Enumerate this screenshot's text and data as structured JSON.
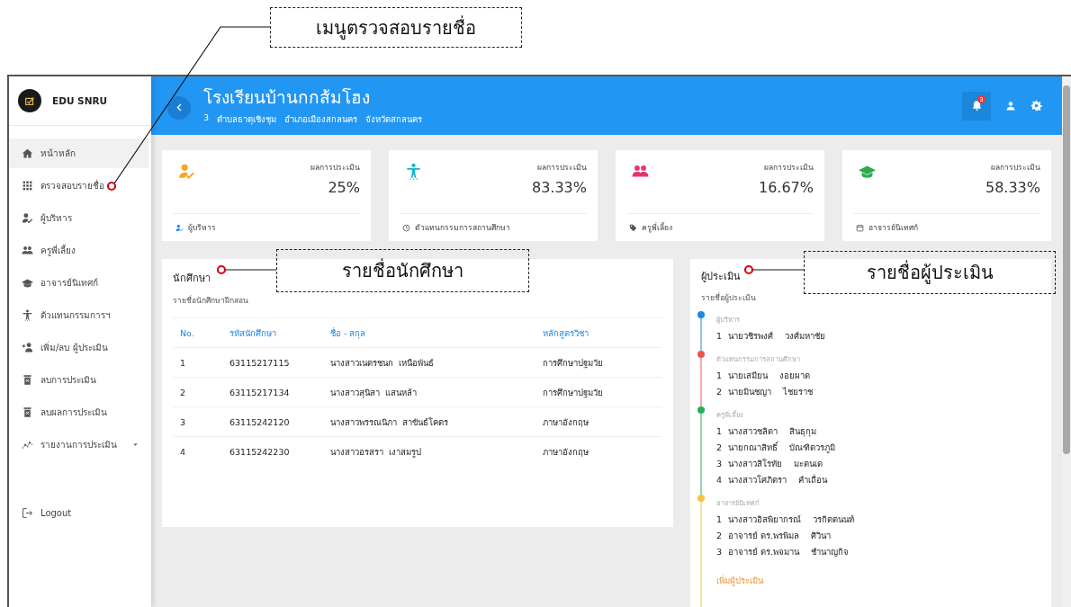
{
  "callouts": [
    {
      "text": "เมนูตรวจสอบรายชื่อ"
    },
    {
      "text": "รายชื่อนักศึกษา"
    },
    {
      "text": "รายชื่อผู้ประเมิน"
    }
  ],
  "sidebar": {
    "brand": "EDU SNRU",
    "items": [
      {
        "label": "หน้าหลัก",
        "kind": "home",
        "selected": true
      },
      {
        "label": "ตรวจสอบรายชื่อ",
        "kind": "grid",
        "selected": false
      },
      {
        "label": "ผู้บริหาร",
        "kind": "user-check",
        "selected": false
      },
      {
        "label": "ครูพี่เลี้ยง",
        "kind": "users",
        "selected": false
      },
      {
        "label": "อาจารย์นิเทศก์",
        "kind": "graduation",
        "selected": false
      },
      {
        "label": "ตัวแทนกรรมการฯ",
        "kind": "accessibility",
        "selected": false
      },
      {
        "label": "เพิ่ม/ลบ ผู้ประเมิน",
        "kind": "user-plus",
        "selected": false
      },
      {
        "label": "ลบการประเมิน",
        "kind": "trash",
        "selected": false
      },
      {
        "label": "ลบผลการประเมิน",
        "kind": "trash",
        "selected": false
      },
      {
        "label": "รายงานการประเมิน",
        "kind": "chart",
        "selected": false,
        "submenu": true
      }
    ],
    "logout": "Logout"
  },
  "header": {
    "title": "โรงเรียนบ้านกกส้มโฮง",
    "address": [
      "3",
      "ตำบลธาตุเชิงชุม",
      "อำเภอเมืองสกลนคร",
      "จังหวัดสกลนคร"
    ],
    "notifications": "3"
  },
  "cards": [
    {
      "kind": "executive",
      "color": "#f5a623",
      "label": "ผลการประเมิน",
      "value": "25%",
      "footer": "ผู้บริหาร"
    },
    {
      "kind": "committee",
      "color": "#17b3c9",
      "label": "ผลการประเมิน",
      "value": "83.33%",
      "footer": "ตัวแทนกรรมการสถานศึกษา"
    },
    {
      "kind": "mentor",
      "color": "#e8336a",
      "label": "ผลการประเมิน",
      "value": "16.67%",
      "footer": "ครูพี่เลี้ยง"
    },
    {
      "kind": "supervisor",
      "color": "#2eaa4f",
      "label": "ผลการประเมิน",
      "value": "58.33%",
      "footer": "อาจารย์นิเทศก์"
    }
  ],
  "students": {
    "title": "นักศึกษา",
    "subtitle": "รายชื่อนักศึกษาฝึกสอน",
    "columns": [
      "No.",
      "รหัสนักศึกษา",
      "ชื่อ - สกุล",
      "หลักสูตรวิชา"
    ],
    "rows": [
      [
        "1",
        "63115217115",
        "นางสาวเนตรชนก  เหนือพันธ์",
        "การศึกษาปฐมวัย"
      ],
      [
        "2",
        "63115217134",
        "นางสาวสุนิสา  แสนหล้า",
        "การศึกษาปฐมวัย"
      ],
      [
        "3",
        "63115242120",
        "นางสาวพรรณนิภา  สาขันธ์โคตร",
        "ภาษาอังกฤษ"
      ],
      [
        "4",
        "63115242230",
        "นางสาวอรสรา  เงาสมรูป",
        "ภาษาอังกฤษ"
      ]
    ]
  },
  "evaluators": {
    "title": "ผู้ประเมิน",
    "subtitle": "รายชื่อผู้ประเมิน",
    "groups": [
      {
        "title": "ผู้บริหาร",
        "color": "#1e88e5",
        "people": [
          {
            "no": "1",
            "name": "นายวชิรพงศ์",
            "surname": "วงศ์มหาชัย"
          }
        ]
      },
      {
        "title": "ตัวแทนกรรมการสถานศึกษา",
        "color": "#ef5350",
        "people": [
          {
            "no": "1",
            "name": "นายเสมียน",
            "surname": "งอยผาด"
          },
          {
            "no": "2",
            "name": "นายมินชญา",
            "surname": "ไชยราช"
          }
        ]
      },
      {
        "title": "ครูพี่เลี้ยง",
        "color": "#21b35b",
        "people": [
          {
            "no": "1",
            "name": "นางสาวชลิดา",
            "surname": "สินธุกุม"
          },
          {
            "no": "2",
            "name": "นายกณาสิทธิ์",
            "surname": "บัณฑิตวรภูมิ"
          },
          {
            "no": "3",
            "name": "นางสาวสิโรทัย",
            "surname": "มะตนเด"
          },
          {
            "no": "4",
            "name": "นางสาวโศภิตรา",
            "surname": "คำเถื่อน"
          }
        ]
      },
      {
        "title": "อาจารย์นิเทศก์",
        "color": "#f7c244",
        "people": [
          {
            "no": "1",
            "name": "นางสาวอิสพิยากรณ์",
            "surname": "วรกิตตนนท์"
          },
          {
            "no": "2",
            "name": "อาจารย์ ดร.พรพิมล",
            "surname": "ศิวินา"
          },
          {
            "no": "3",
            "name": "อาจารย์ ดร.พจมาน",
            "surname": "ชำนาญกิจ"
          }
        ]
      }
    ],
    "add_link": "เพิ่มผู้ประเมิน"
  }
}
